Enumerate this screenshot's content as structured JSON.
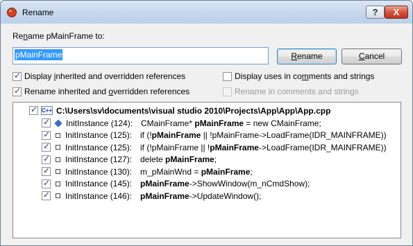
{
  "window": {
    "title": "Rename",
    "help_glyph": "?",
    "close_glyph": "X"
  },
  "prompt": {
    "prefix": "Re",
    "mnemonic": "n",
    "suffix": "ame pMainFrame to:"
  },
  "name_input": {
    "value": "pMainFrame"
  },
  "buttons": {
    "rename": {
      "mnemonic": "R",
      "rest": "ename"
    },
    "cancel": {
      "mnemonic": "C",
      "rest": "ancel"
    }
  },
  "options": {
    "display_inherited": {
      "before": "Display ",
      "mnemonic": "i",
      "after": "nherited and overridden references",
      "checked": true
    },
    "display_uses": {
      "before": "Display uses in co",
      "mnemonic": "m",
      "after": "ments and strings",
      "checked": false
    },
    "rename_inherited": {
      "before": "Rename inherited and ",
      "mnemonic": "o",
      "after": "verridden references",
      "checked": true
    },
    "rename_comments": {
      "label": "Rename in comments and strings",
      "checked": false,
      "disabled": true
    }
  },
  "tree": {
    "file": {
      "icon": "C++",
      "path": "C:\\Users\\sv\\documents\\visual studio 2010\\Projects\\App\\App\\App.cpp",
      "checked": true
    },
    "rows": [
      {
        "icon": "diamond-icon",
        "location": "InitInstance (124):",
        "pre": "CMainFrame* ",
        "bold": "pMainFrame",
        "post": " = new CMainFrame;",
        "checked": true
      },
      {
        "icon": "square-icon",
        "location": "InitInstance (125):",
        "pre": "if (!",
        "bold": "pMainFrame",
        "post": " || !pMainFrame->LoadFrame(IDR_MAINFRAME))",
        "checked": true
      },
      {
        "icon": "square-icon",
        "location": "InitInstance (125):",
        "pre": "if (!pMainFrame || !",
        "bold": "pMainFrame",
        "post": "->LoadFrame(IDR_MAINFRAME))",
        "checked": true
      },
      {
        "icon": "square-icon",
        "location": "InitInstance (127):",
        "pre": "delete ",
        "bold": "pMainFrame",
        "post": ";",
        "checked": true
      },
      {
        "icon": "square-icon",
        "location": "InitInstance (130):",
        "pre": "m_pMainWnd = ",
        "bold": "pMainFrame",
        "post": ";",
        "checked": true
      },
      {
        "icon": "square-icon",
        "location": "InitInstance (145):",
        "pre": "",
        "bold": "pMainFrame",
        "post": "->ShowWindow(m_nCmdShow);",
        "checked": true
      },
      {
        "icon": "square-icon",
        "location": "InitInstance (146):",
        "pre": "",
        "bold": "pMainFrame",
        "post": "->UpdateWindow();",
        "checked": true
      }
    ]
  },
  "colors": {
    "selection": "#3399ff",
    "reference_icon": "#3a69c9"
  }
}
